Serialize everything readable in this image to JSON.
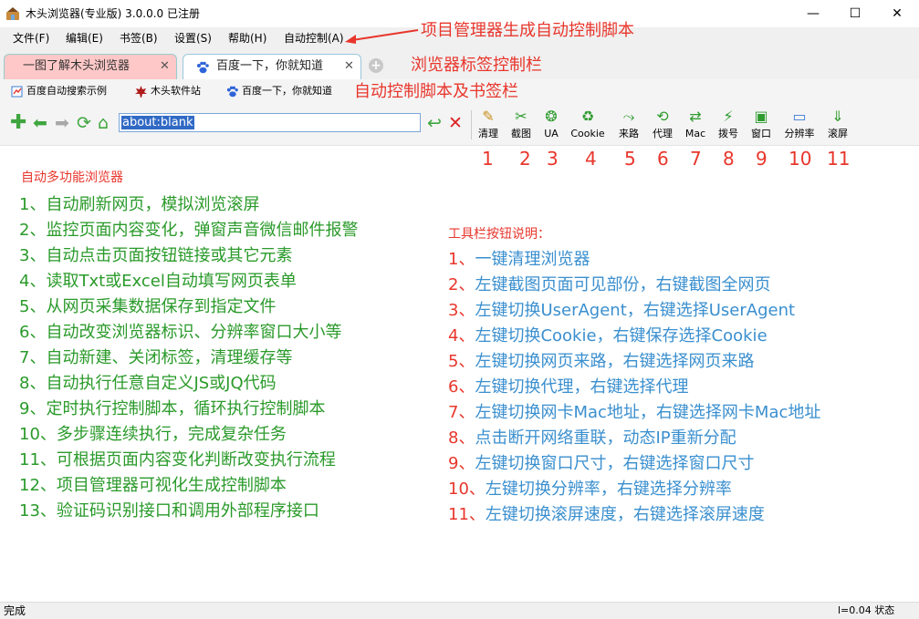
{
  "window": {
    "title": "木头浏览器(专业版) 3.0.0.0  已注册",
    "min": "—",
    "max": "☐",
    "close": "✕"
  },
  "menu": [
    "文件(F)",
    "编辑(E)",
    "书签(B)",
    "设置(S)",
    "帮助(H)",
    "自动控制(A)"
  ],
  "tabs": [
    {
      "label": "一图了解木头浏览器",
      "close": "✕"
    },
    {
      "label": "百度一下，你就知道",
      "close": "✕"
    }
  ],
  "new_tab": "+",
  "bookmarks": [
    "百度自动搜索示例",
    "木头软件站",
    "百度一下，你就知道"
  ],
  "url": {
    "value": "about:blank"
  },
  "tool_buttons": [
    "清理",
    "截图",
    "UA",
    "Cookie",
    "来路",
    "代理",
    "Mac",
    "拨号",
    "窗口",
    "分辨率",
    "滚屏"
  ],
  "tool_numbers": [
    "1",
    "2",
    "3",
    "4",
    "5",
    "6",
    "7",
    "8",
    "9",
    "10",
    "11"
  ],
  "annotations": {
    "menu": "项目管理器生成自动控制脚本",
    "tabs": "浏览器标签控制栏",
    "bookmarks": "自动控制脚本及书签栏"
  },
  "features": {
    "heading": "自动多功能浏览器",
    "items": [
      "1、自动刷新网页，模拟浏览滚屏",
      "2、监控页面内容变化，弹窗声音微信邮件报警",
      "3、自动点击页面按钮链接或其它元素",
      "4、读取Txt或Excel自动填写网页表单",
      "5、从网页采集数据保存到指定文件",
      "6、自动改变浏览器标识、分辨率窗口大小等",
      "7、自动新建、关闭标签，清理缓存等",
      "8、自动执行任意自定义JS或JQ代码",
      "9、定时执行控制脚本，循环执行控制脚本",
      "10、多步骤连续执行，完成复杂任务",
      "11、可根据页面内容变化判断改变执行流程",
      "12、项目管理器可视化生成控制脚本",
      "13、验证码识别接口和调用外部程序接口"
    ]
  },
  "help": {
    "heading": "工具栏按钮说明：",
    "items": [
      {
        "n": "1、",
        "t": "一键清理浏览器"
      },
      {
        "n": "2、",
        "t": "左键截图页面可见部份，右键截图全网页"
      },
      {
        "n": "3、",
        "t": "左键切换UserAgent，右键选择UserAgent"
      },
      {
        "n": "4、",
        "t": "左键切换Cookie，右键保存选择Cookie"
      },
      {
        "n": "5、",
        "t": "左键切换网页来路，右键选择网页来路"
      },
      {
        "n": "6、",
        "t": "左键切换代理，右键选择代理"
      },
      {
        "n": "7、",
        "t": "左键切换网卡Mac地址，右键选择网卡Mac地址"
      },
      {
        "n": "8、",
        "t": "点击断开网络重联，动态IP重新分配"
      },
      {
        "n": "9、",
        "t": "左键切换窗口尺寸，右键选择窗口尺寸"
      },
      {
        "n": "10、",
        "t": "左键切换分辨率，右键选择分辨率"
      },
      {
        "n": "11、",
        "t": "左键切换滚屏速度，右键选择滚屏速度"
      }
    ]
  },
  "status": {
    "left": "完成",
    "right": "l=0.04  状态"
  }
}
